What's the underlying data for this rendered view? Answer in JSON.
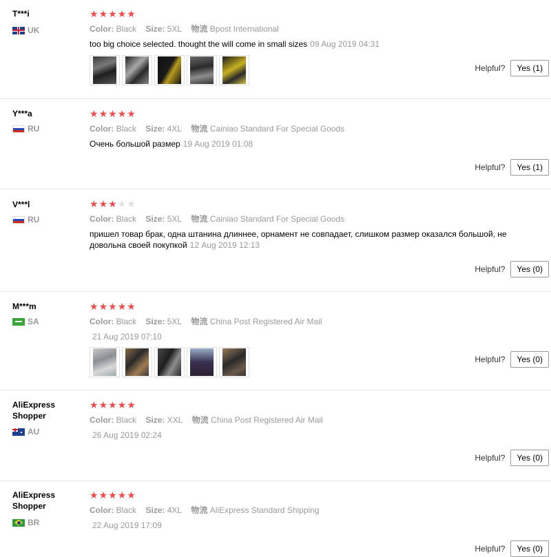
{
  "labels": {
    "color": "Color:",
    "size": "Size:",
    "shipping": "物流",
    "helpful": "Helpful?"
  },
  "colors": {
    "star_on": "#ef4b4b",
    "star_off": "#e0e0e0"
  },
  "reviews": [
    {
      "user": "T***i",
      "country": "UK",
      "flag": "uk-flag-icon",
      "stars": 5,
      "color": "Black",
      "size": "5XL",
      "shipping": "Bpost International",
      "text": "too big choice selected. thought the will come in small sizes",
      "date": "09 Aug 2019 04:31",
      "helpful": "Yes (1)",
      "photos": [
        "product-photo-1",
        "product-photo-2",
        "product-photo-3",
        "product-photo-4",
        "product-photo-5"
      ]
    },
    {
      "user": "Y***a",
      "country": "RU",
      "flag": "ru-flag-icon",
      "stars": 5,
      "color": "Black",
      "size": "4XL",
      "shipping": "Cainiao Standard For Special Goods",
      "text": "Очень большой размер",
      "date": "19 Aug 2019 01:08",
      "helpful": "Yes (1)",
      "photos": []
    },
    {
      "user": "V***l",
      "country": "RU",
      "flag": "ru-flag-icon",
      "stars": 3,
      "color": "Black",
      "size": "5XL",
      "shipping": "Cainiao Standard For Special Goods",
      "text": "пришел товар брак, одна штанина длиннее, орнамент не совпадает, слишком размер оказался большой, не довольна своей покупкой",
      "date": "12 Aug 2019 12:13",
      "helpful": "Yes (0)",
      "photos": []
    },
    {
      "user": "M***m",
      "country": "SA",
      "flag": "sa-flag-icon",
      "stars": 5,
      "color": "Black",
      "size": "5XL",
      "shipping": "China Post Registered Air Mail",
      "text": "",
      "date": "21 Aug 2019 07:10",
      "helpful": "Yes (0)",
      "photos": [
        "product-photo-1",
        "product-photo-2",
        "product-photo-3",
        "product-photo-4",
        "product-photo-5"
      ]
    },
    {
      "user": "AliExpress Shopper",
      "country": "AU",
      "flag": "au-flag-icon",
      "stars": 5,
      "color": "Black",
      "size": "XXL",
      "shipping": "China Post Registered Air Mail",
      "text": "",
      "date": "26 Aug 2019 02:24",
      "helpful": "Yes (0)",
      "photos": []
    },
    {
      "user": "AliExpress Shopper",
      "country": "BR",
      "flag": "br-flag-icon",
      "stars": 5,
      "color": "Black",
      "size": "4XL",
      "shipping": "AliExpress Standard Shipping",
      "text": "",
      "date": "22 Aug 2019 17:09",
      "helpful": "Yes (0)",
      "photos": []
    }
  ]
}
